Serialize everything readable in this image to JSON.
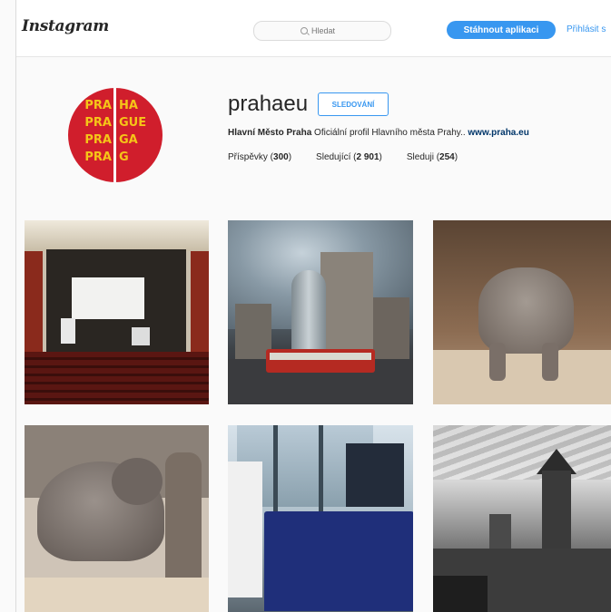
{
  "header": {
    "logo": "Instagram",
    "search_placeholder": "Hledat",
    "download_label": "Stáhnout aplikaci",
    "login_label": "Přihlásit s"
  },
  "profile": {
    "avatar_lines_left": [
      "PRA",
      "PRA",
      "PRA",
      "PRA"
    ],
    "avatar_lines_right": [
      "HA",
      "GUE",
      "GA",
      "G"
    ],
    "username": "prahaeu",
    "follow_label": "SLEDOVÁNÍ",
    "full_name": "Hlavní Město Praha",
    "bio": "Oficiální profil Hlavního města Prahy..",
    "website": "www.praha.eu",
    "stats": {
      "posts_label": "Příspěvky",
      "posts_count": "300",
      "followers_label": "Sledující",
      "followers_count": "2 901",
      "following_label": "Sleduji",
      "following_count": "254"
    }
  },
  "photos": [
    {
      "subject": "cinema hall"
    },
    {
      "subject": "dancing house tram"
    },
    {
      "subject": "baby elephant"
    },
    {
      "subject": "elephant calf"
    },
    {
      "subject": "conference room"
    },
    {
      "subject": "old town towers bw"
    }
  ],
  "colors": {
    "accent": "#3897f0",
    "avatar_red": "#d01e2c",
    "avatar_yellow": "#f5c518",
    "background": "#fafafa"
  }
}
